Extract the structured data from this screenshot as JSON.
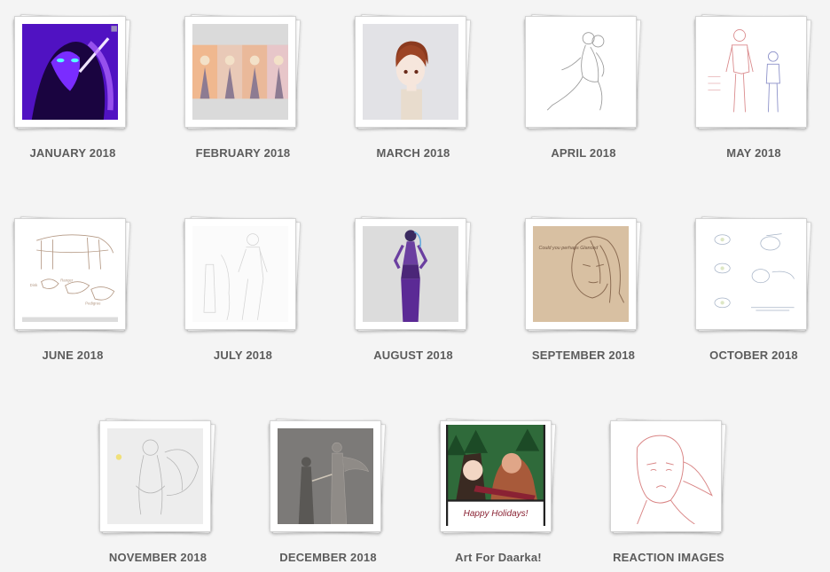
{
  "gallery": {
    "folders": [
      {
        "label": "JANUARY 2018"
      },
      {
        "label": "FEBRUARY 2018"
      },
      {
        "label": "MARCH 2018"
      },
      {
        "label": "APRIL 2018"
      },
      {
        "label": "MAY 2018"
      },
      {
        "label": "JUNE 2018"
      },
      {
        "label": "JULY 2018"
      },
      {
        "label": "AUGUST 2018"
      },
      {
        "label": "SEPTEMBER 2018"
      },
      {
        "label": "OCTOBER 2018"
      },
      {
        "label": "NOVEMBER 2018"
      },
      {
        "label": "DECEMBER 2018"
      },
      {
        "label": "Art For Daarka!",
        "caption": "Happy Holidays!"
      },
      {
        "label": "REACTION IMAGES"
      }
    ],
    "sketch_notes": {
      "june_a": "Dink",
      "june_b": "Ranger",
      "june_c": "Pedigree",
      "september": "Could you perhaps Glanced"
    }
  }
}
